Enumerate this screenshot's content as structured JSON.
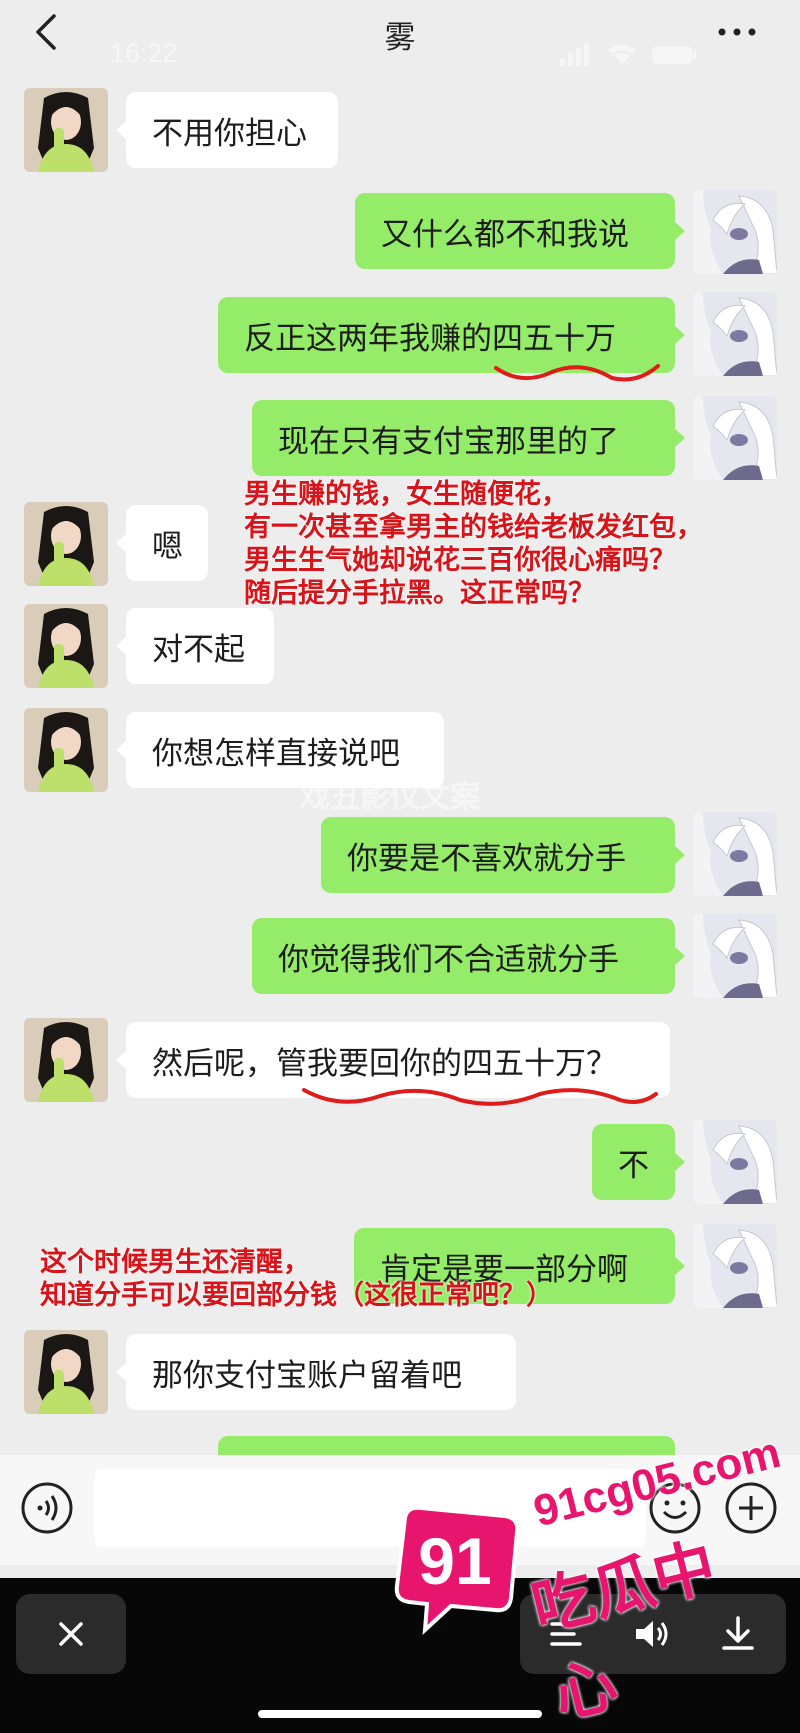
{
  "header": {
    "title": "雾",
    "time": "16:22"
  },
  "messages": [
    {
      "side": "in",
      "text": "不用你担心"
    },
    {
      "side": "out",
      "text": "又什么都不和我说"
    },
    {
      "side": "out",
      "text": "反正这两年我赚的四五十万"
    },
    {
      "side": "out",
      "text": "现在只有支付宝那里的了"
    },
    {
      "side": "in",
      "text": "嗯"
    },
    {
      "side": "in",
      "text": "对不起"
    },
    {
      "side": "in",
      "text": "你想怎样直接说吧"
    },
    {
      "side": "out",
      "text": "你要是不喜欢就分手"
    },
    {
      "side": "out",
      "text": "你觉得我们不合适就分手"
    },
    {
      "side": "in",
      "text": "然后呢，管我要回你的四五十万？"
    },
    {
      "side": "out",
      "text": "不"
    },
    {
      "side": "out",
      "text": "肯定是要一部分啊"
    },
    {
      "side": "in",
      "text": "那你支付宝账户留着吧"
    }
  ],
  "annotations": {
    "note1": [
      "男生赚的钱，女生随便花，",
      "有一次甚至拿男主的钱给老板发红包，",
      "男生生气她却说花三百你很心痛吗？",
      "随后提分手拉黑。这正常吗？"
    ],
    "note2": [
      "这个时候男生还清醒，",
      "知道分手可以要回部分钱（这很正常吧？）"
    ]
  },
  "watermark": "戏丑影仪文案",
  "logo": {
    "number": "91",
    "url": "91cg05.com",
    "title": "吃瓜中心"
  },
  "colors": {
    "incoming": "#ffffff",
    "outgoing": "#95ec69",
    "annotation": "#d7141a",
    "logo": "#e8156f"
  },
  "icons": [
    "back-icon",
    "more-icon",
    "voice-icon",
    "emoji-icon",
    "plus-icon",
    "close-icon",
    "menu-icon",
    "speaker-icon",
    "download-icon"
  ]
}
